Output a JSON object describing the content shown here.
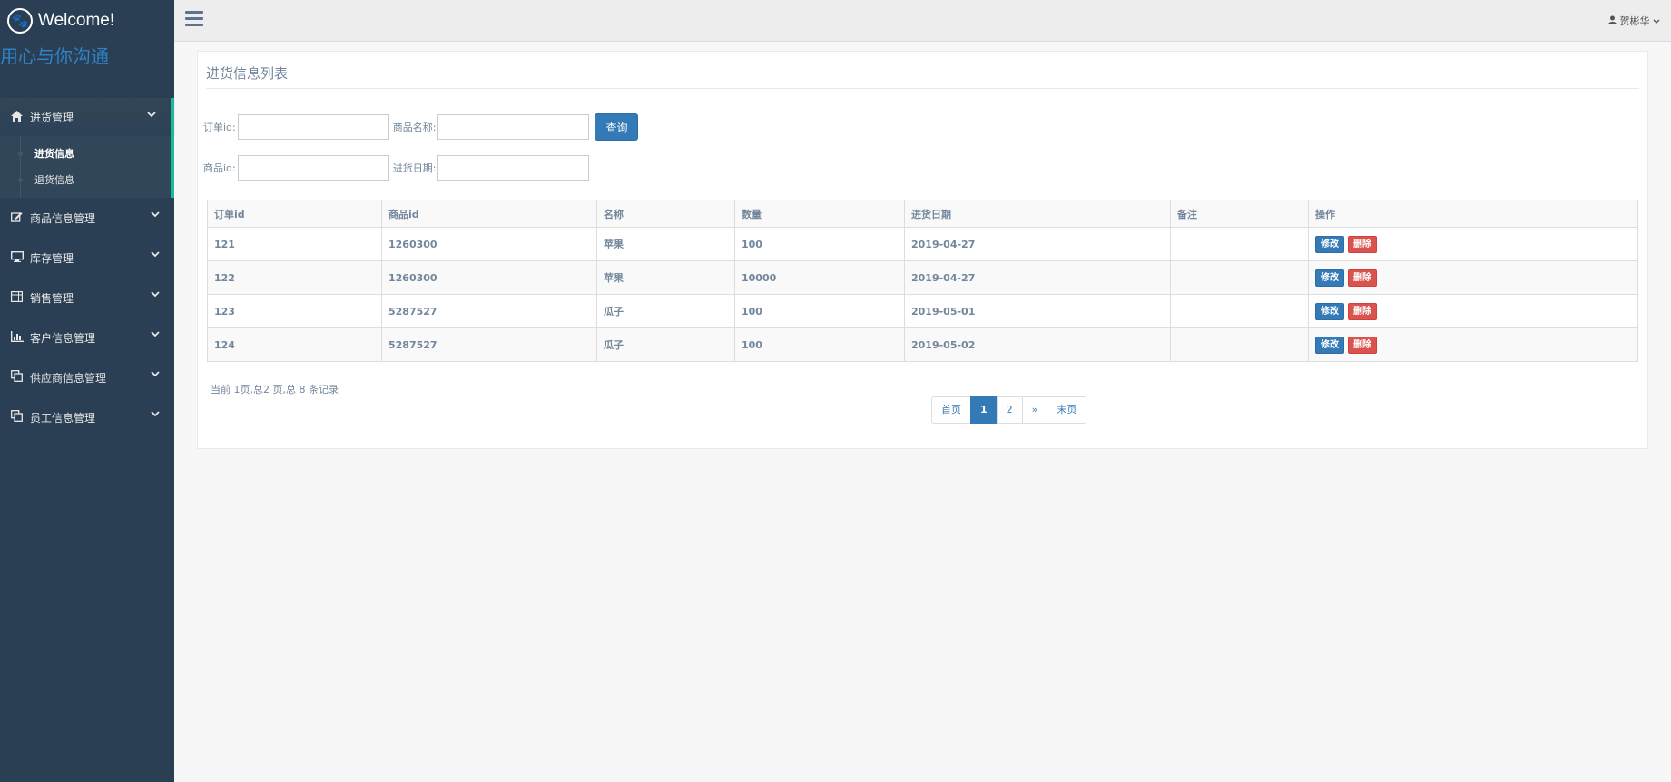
{
  "brand": {
    "title": "Welcome!",
    "slogan": "用心与你沟通",
    "logo_icon": "paw-icon"
  },
  "sidebar": {
    "items": [
      {
        "label": "进货管理",
        "icon": "home-icon",
        "active": true,
        "children": [
          {
            "label": "进货信息",
            "current": true
          },
          {
            "label": "退货信息",
            "current": false
          }
        ]
      },
      {
        "label": "商品信息管理",
        "icon": "edit-icon"
      },
      {
        "label": "库存管理",
        "icon": "desktop-icon"
      },
      {
        "label": "销售管理",
        "icon": "table-icon"
      },
      {
        "label": "客户信息管理",
        "icon": "bar-chart-icon"
      },
      {
        "label": "供应商信息管理",
        "icon": "clone-icon"
      },
      {
        "label": "员工信息管理",
        "icon": "clone-icon"
      }
    ]
  },
  "topbar": {
    "user_name": "贺彬华"
  },
  "panel": {
    "title": "进货信息列表"
  },
  "search": {
    "order_id_label": "订单id:",
    "product_name_label": "商品名称:",
    "query_button": "查询",
    "product_id_label": "商品id:",
    "purchase_date_label": "进货日期:",
    "order_id_value": "",
    "product_name_value": "",
    "product_id_value": "",
    "purchase_date_value": ""
  },
  "table": {
    "headers": [
      "订单id",
      "商品id",
      "名称",
      "数量",
      "进货日期",
      "备注",
      "操作"
    ],
    "rows": [
      {
        "order_id": "121",
        "product_id": "1260300",
        "name": "苹果",
        "quantity": "100",
        "date": "2019-04-27",
        "note": ""
      },
      {
        "order_id": "122",
        "product_id": "1260300",
        "name": "苹果",
        "quantity": "10000",
        "date": "2019-04-27",
        "note": ""
      },
      {
        "order_id": "123",
        "product_id": "5287527",
        "name": "瓜子",
        "quantity": "100",
        "date": "2019-05-01",
        "note": ""
      },
      {
        "order_id": "124",
        "product_id": "5287527",
        "name": "瓜子",
        "quantity": "100",
        "date": "2019-05-02",
        "note": ""
      }
    ],
    "edit_label": "修改",
    "delete_label": "删除"
  },
  "pagination": {
    "info": "当前 1页,总2 页,总 8 条记录",
    "first": "首页",
    "pages": [
      "1",
      "2"
    ],
    "next": "»",
    "last": "末页",
    "current": "1"
  },
  "colors": {
    "sidebar_bg": "#2A3F54",
    "accent": "#1ABB9C",
    "primary": "#337ab7",
    "danger": "#d9534f"
  }
}
